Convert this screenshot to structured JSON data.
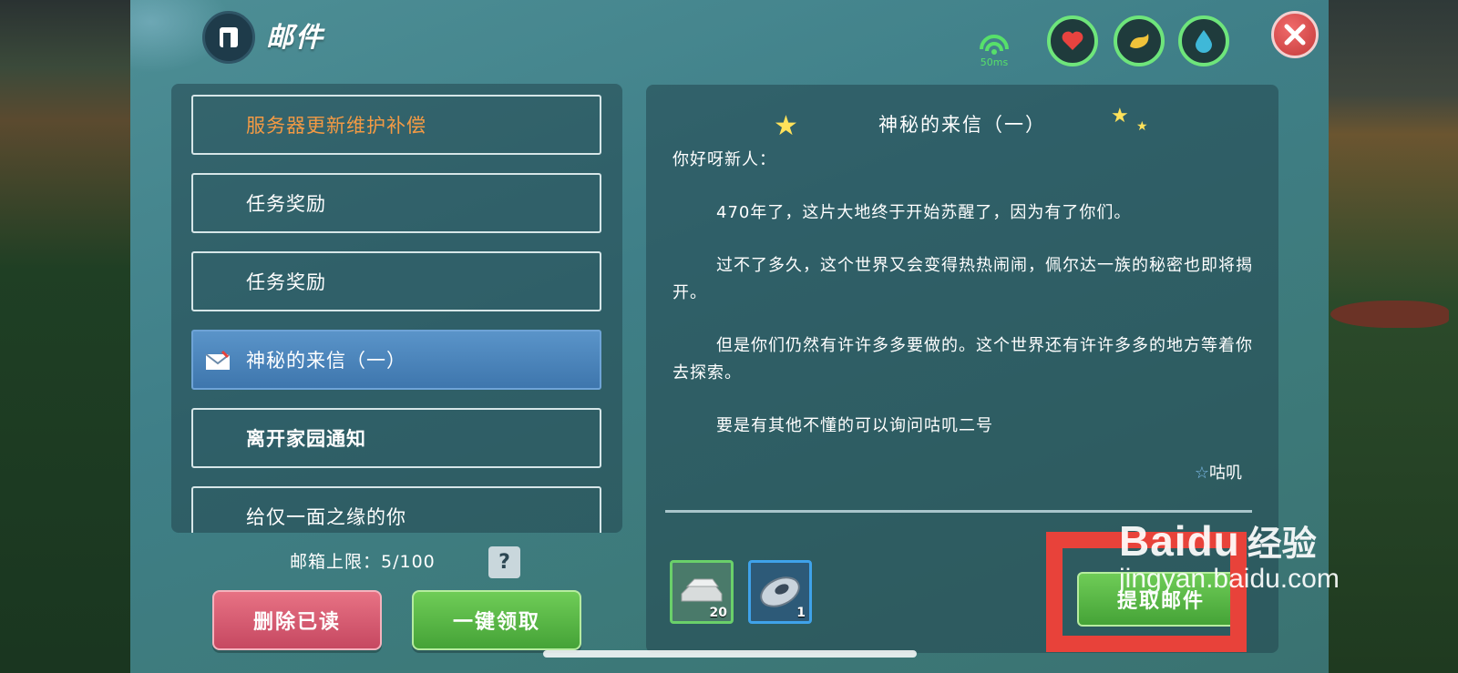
{
  "header": {
    "title": "邮件",
    "latency": "50ms"
  },
  "stats": {
    "heart_color": "#e8433f",
    "food_color": "#f0c23a",
    "water_color": "#3fb8d8",
    "ring_color": "#6ee57b"
  },
  "mail_list": [
    {
      "label": "服务器更新维护补偿",
      "state": "unread-highlight"
    },
    {
      "label": "任务奖励",
      "state": "normal"
    },
    {
      "label": "任务奖励",
      "state": "normal"
    },
    {
      "label": "神秘的来信（一）",
      "state": "selected"
    },
    {
      "label": "离开家园通知",
      "state": "bold"
    },
    {
      "label": "给仅一面之缘的你",
      "state": "partially-visible"
    }
  ],
  "mailbox": {
    "limit_text": "邮箱上限：5/100",
    "help_label": "?"
  },
  "buttons": {
    "delete_read": "删除已读",
    "claim_all": "一键领取",
    "claim_mail": "提取邮件"
  },
  "detail": {
    "title": "神秘的来信（一）",
    "greeting": "你好呀新人：",
    "paragraphs": [
      "470年了，这片大地终于开始苏醒了，因为有了你们。",
      "过不了多久，这个世界又会变得热热闹闹，佩尔达一族的秘密也即将揭开。",
      "但是你们仍然有许许多多要做的。这个世界还有许许多多的地方等着你去探索。",
      "要是有其他不懂的可以询问咕叽二号"
    ],
    "signature_mark": "☆",
    "signature": "咕叽",
    "rewards": [
      {
        "item": "silver-ingot",
        "count": "20"
      },
      {
        "item": "disc",
        "count": "1"
      }
    ]
  },
  "watermark": {
    "brand": "Baidu",
    "brand_cn": "经验",
    "url": "jingyan.baidu.com"
  }
}
